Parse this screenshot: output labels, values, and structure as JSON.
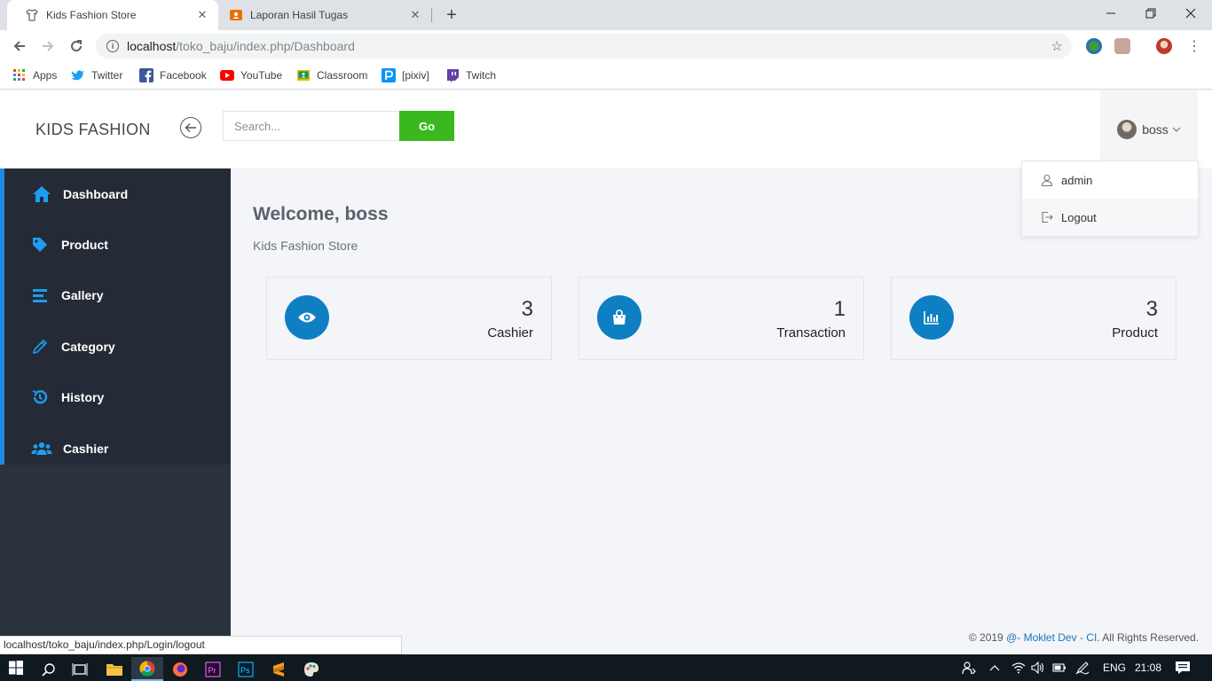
{
  "browser": {
    "tabs": [
      {
        "title": "Kids Fashion Store",
        "active": true,
        "icon": "shirt-icon"
      },
      {
        "title": "Laporan Hasil Tugas",
        "active": false,
        "icon": "classroom-icon"
      }
    ],
    "url_host": "localhost",
    "url_path": "/toko_baju/index.php/Dashboard",
    "bookmarks": [
      {
        "label": "Apps",
        "icon": "apps-grid-icon"
      },
      {
        "label": "Twitter",
        "icon": "twitter-icon"
      },
      {
        "label": "Facebook",
        "icon": "facebook-icon"
      },
      {
        "label": "YouTube",
        "icon": "youtube-icon"
      },
      {
        "label": "Classroom",
        "icon": "classroom-icon"
      },
      {
        "label": "[pixiv]",
        "icon": "pixiv-icon"
      },
      {
        "label": "Twitch",
        "icon": "twitch-icon"
      }
    ],
    "status_url": "localhost/toko_baju/index.php/Login/logout"
  },
  "header": {
    "brand": "KIDS FASHION",
    "search_placeholder": "Search...",
    "go_label": "Go",
    "username": "boss"
  },
  "dropdown": {
    "items": [
      {
        "label": "admin",
        "icon": "user-icon"
      },
      {
        "label": "Logout",
        "icon": "logout-icon"
      }
    ]
  },
  "sidebar": {
    "items": [
      {
        "label": "Dashboard",
        "icon": "home-icon"
      },
      {
        "label": "Product",
        "icon": "tag-icon"
      },
      {
        "label": "Gallery",
        "icon": "list-icon"
      },
      {
        "label": "Category",
        "icon": "pencil-icon"
      },
      {
        "label": "History",
        "icon": "history-icon"
      },
      {
        "label": "Cashier",
        "icon": "users-icon"
      }
    ]
  },
  "main": {
    "welcome": "Welcome, boss",
    "subtitle": "Kids Fashion Store",
    "stats": [
      {
        "value": "3",
        "label": "Cashier",
        "icon": "eye-icon"
      },
      {
        "value": "1",
        "label": "Transaction",
        "icon": "shopping-bag-icon"
      },
      {
        "value": "3",
        "label": "Product",
        "icon": "bar-chart-icon"
      }
    ],
    "footer_prefix": "© 2019 ",
    "footer_link": "@- Moklet Dev - CI",
    "footer_suffix": ". All Rights Reserved."
  },
  "taskbar": {
    "language": "ENG",
    "time": "21:08"
  },
  "colors": {
    "sidebar_bg": "#2a323e",
    "sidebar_active_strip": "#1e88e5",
    "accent_blue": "#0f7fc4",
    "go_green": "#39b91e"
  }
}
